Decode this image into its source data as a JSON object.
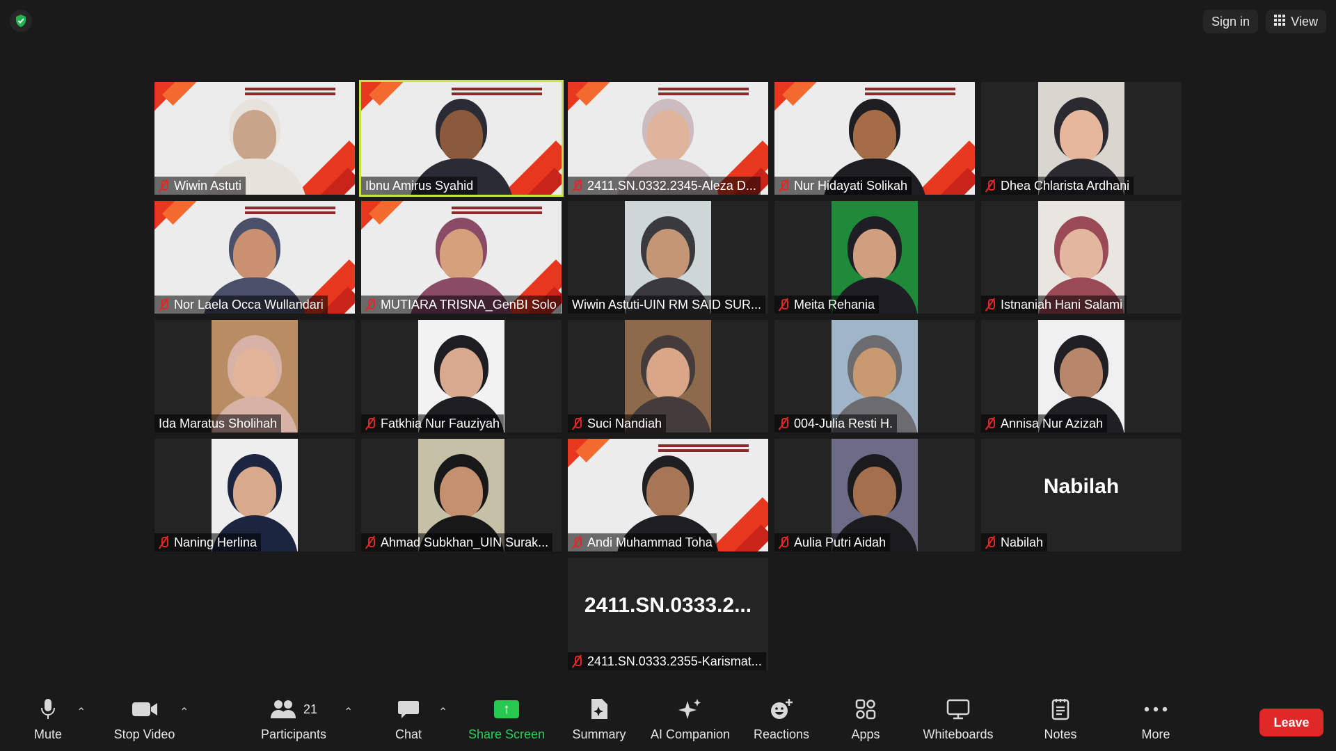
{
  "topbar": {
    "sign_in": "Sign in",
    "view": "View",
    "security_icon": "shield-check-icon"
  },
  "tiles": [
    {
      "name": "Wiwin Astuti",
      "muted": true,
      "bg": "slide",
      "active": false
    },
    {
      "name": "Ibnu Amirus Syahid",
      "muted": false,
      "bg": "slide",
      "active": true
    },
    {
      "name": "2411.SN.0332.2345-Aleza D...",
      "muted": true,
      "bg": "slide",
      "active": false
    },
    {
      "name": "Nur Hidayati Solikah",
      "muted": true,
      "bg": "slide",
      "active": false
    },
    {
      "name": "Dhea Chlarista Ardhani",
      "muted": true,
      "bg": "photo",
      "active": false
    },
    {
      "name": "Nor Laela Occa Wullandari",
      "muted": true,
      "bg": "slide",
      "active": false
    },
    {
      "name": "MUTIARA TRISNA_GenBI Solo",
      "muted": true,
      "bg": "slide",
      "active": false
    },
    {
      "name": "Wiwin Astuti-UIN RM SAID SUR...",
      "muted": false,
      "bg": "photo",
      "active": false
    },
    {
      "name": "Meita Rehania",
      "muted": true,
      "bg": "photo",
      "active": false
    },
    {
      "name": "Istnaniah Hani Salami",
      "muted": true,
      "bg": "photo",
      "active": false
    },
    {
      "name": "Ida Maratus Sholihah",
      "muted": false,
      "bg": "photo",
      "active": false
    },
    {
      "name": "Fatkhia Nur Fauziyah",
      "muted": true,
      "bg": "photo",
      "active": false
    },
    {
      "name": "Suci Nandiah",
      "muted": true,
      "bg": "photo",
      "active": false
    },
    {
      "name": "004-Julia Resti H.",
      "muted": true,
      "bg": "photo",
      "active": false
    },
    {
      "name": "Annisa Nur Azizah",
      "muted": true,
      "bg": "photo",
      "active": false
    },
    {
      "name": "Naning Herlina",
      "muted": true,
      "bg": "photo",
      "active": false
    },
    {
      "name": "Ahmad Subkhan_UIN Surak...",
      "muted": true,
      "bg": "photo",
      "active": false
    },
    {
      "name": "Andi Muhammad Toha",
      "muted": true,
      "bg": "slide",
      "active": false
    },
    {
      "name": "Aulia Putri Aidah",
      "muted": true,
      "bg": "photo",
      "active": false
    },
    {
      "name": "Nabilah",
      "muted": true,
      "bg": "none",
      "bigname": "Nabilah",
      "active": false
    },
    {
      "name": "2411.SN.0333.2355-Karismat...",
      "muted": true,
      "bg": "none",
      "bigname": "2411.SN.0333.2...",
      "active": false
    }
  ],
  "toolbar": {
    "mute": "Mute",
    "stop_video": "Stop Video",
    "participants": "Participants",
    "participants_count": "21",
    "chat": "Chat",
    "share_screen": "Share Screen",
    "summary": "Summary",
    "ai_companion": "AI Companion",
    "reactions": "Reactions",
    "apps": "Apps",
    "whiteboards": "Whiteboards",
    "notes": "Notes",
    "more": "More",
    "leave": "Leave"
  },
  "colors": {
    "active_speaker": "#c6e34a",
    "leave": "#e02828",
    "share": "#26c84f",
    "muted_icon": "#e02828"
  }
}
